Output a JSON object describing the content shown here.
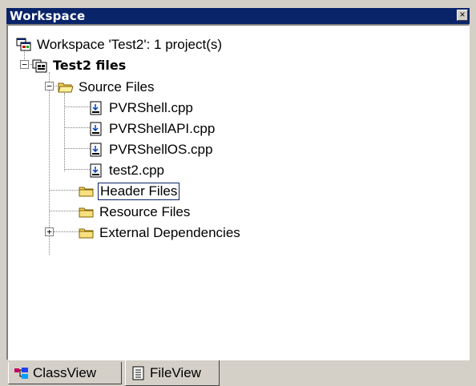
{
  "window": {
    "title": "Workspace",
    "close_label": "×"
  },
  "tree": {
    "workspace": "Workspace 'Test2': 1 project(s)",
    "project": "Test2 files",
    "source_folder": "Source Files",
    "source_files": [
      "PVRShell.cpp",
      "PVRShellAPI.cpp",
      "PVRShellOS.cpp",
      "test2.cpp"
    ],
    "header_folder": "Header Files",
    "resource_folder": "Resource Files",
    "external_folder": "External Dependencies"
  },
  "tabs": [
    {
      "label": "ClassView",
      "icon": "class-view-icon",
      "active": false
    },
    {
      "label": "FileView",
      "icon": "file-view-icon",
      "active": true
    }
  ],
  "colors": {
    "title_bg": "#0a246a",
    "panel_bg": "#d4d0c8",
    "folder": "#f0d060"
  }
}
